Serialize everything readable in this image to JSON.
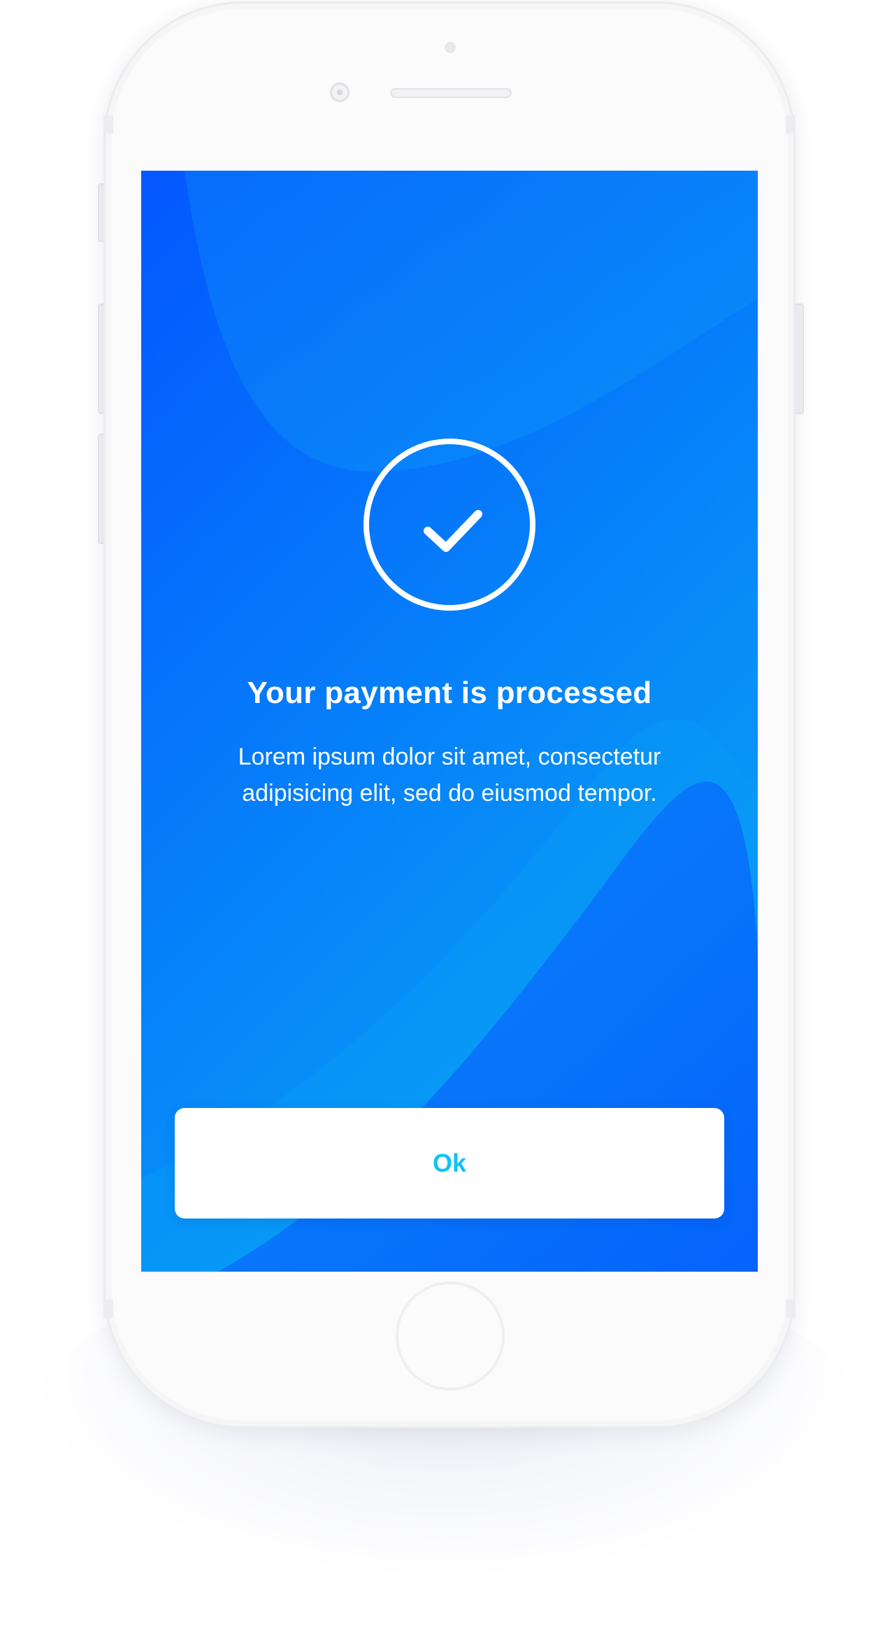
{
  "device": {
    "frame_color": "#fbfbfc",
    "icons": [
      "front-camera-icon",
      "speaker-icon",
      "home-button-icon"
    ]
  },
  "screen": {
    "gradient_colors": [
      "#0457fe",
      "#067ffa",
      "#0898f6"
    ],
    "status_icon": "checkmark-circle-icon",
    "title": "Your payment is processed",
    "description_line1": "Lorem ipsum dolor sit amet, consectetur",
    "description_line2": "adipisicing elit, sed do eiusmod tempor.",
    "ok_button_label": "Ok",
    "ok_label_color": "#0ec3f2"
  }
}
